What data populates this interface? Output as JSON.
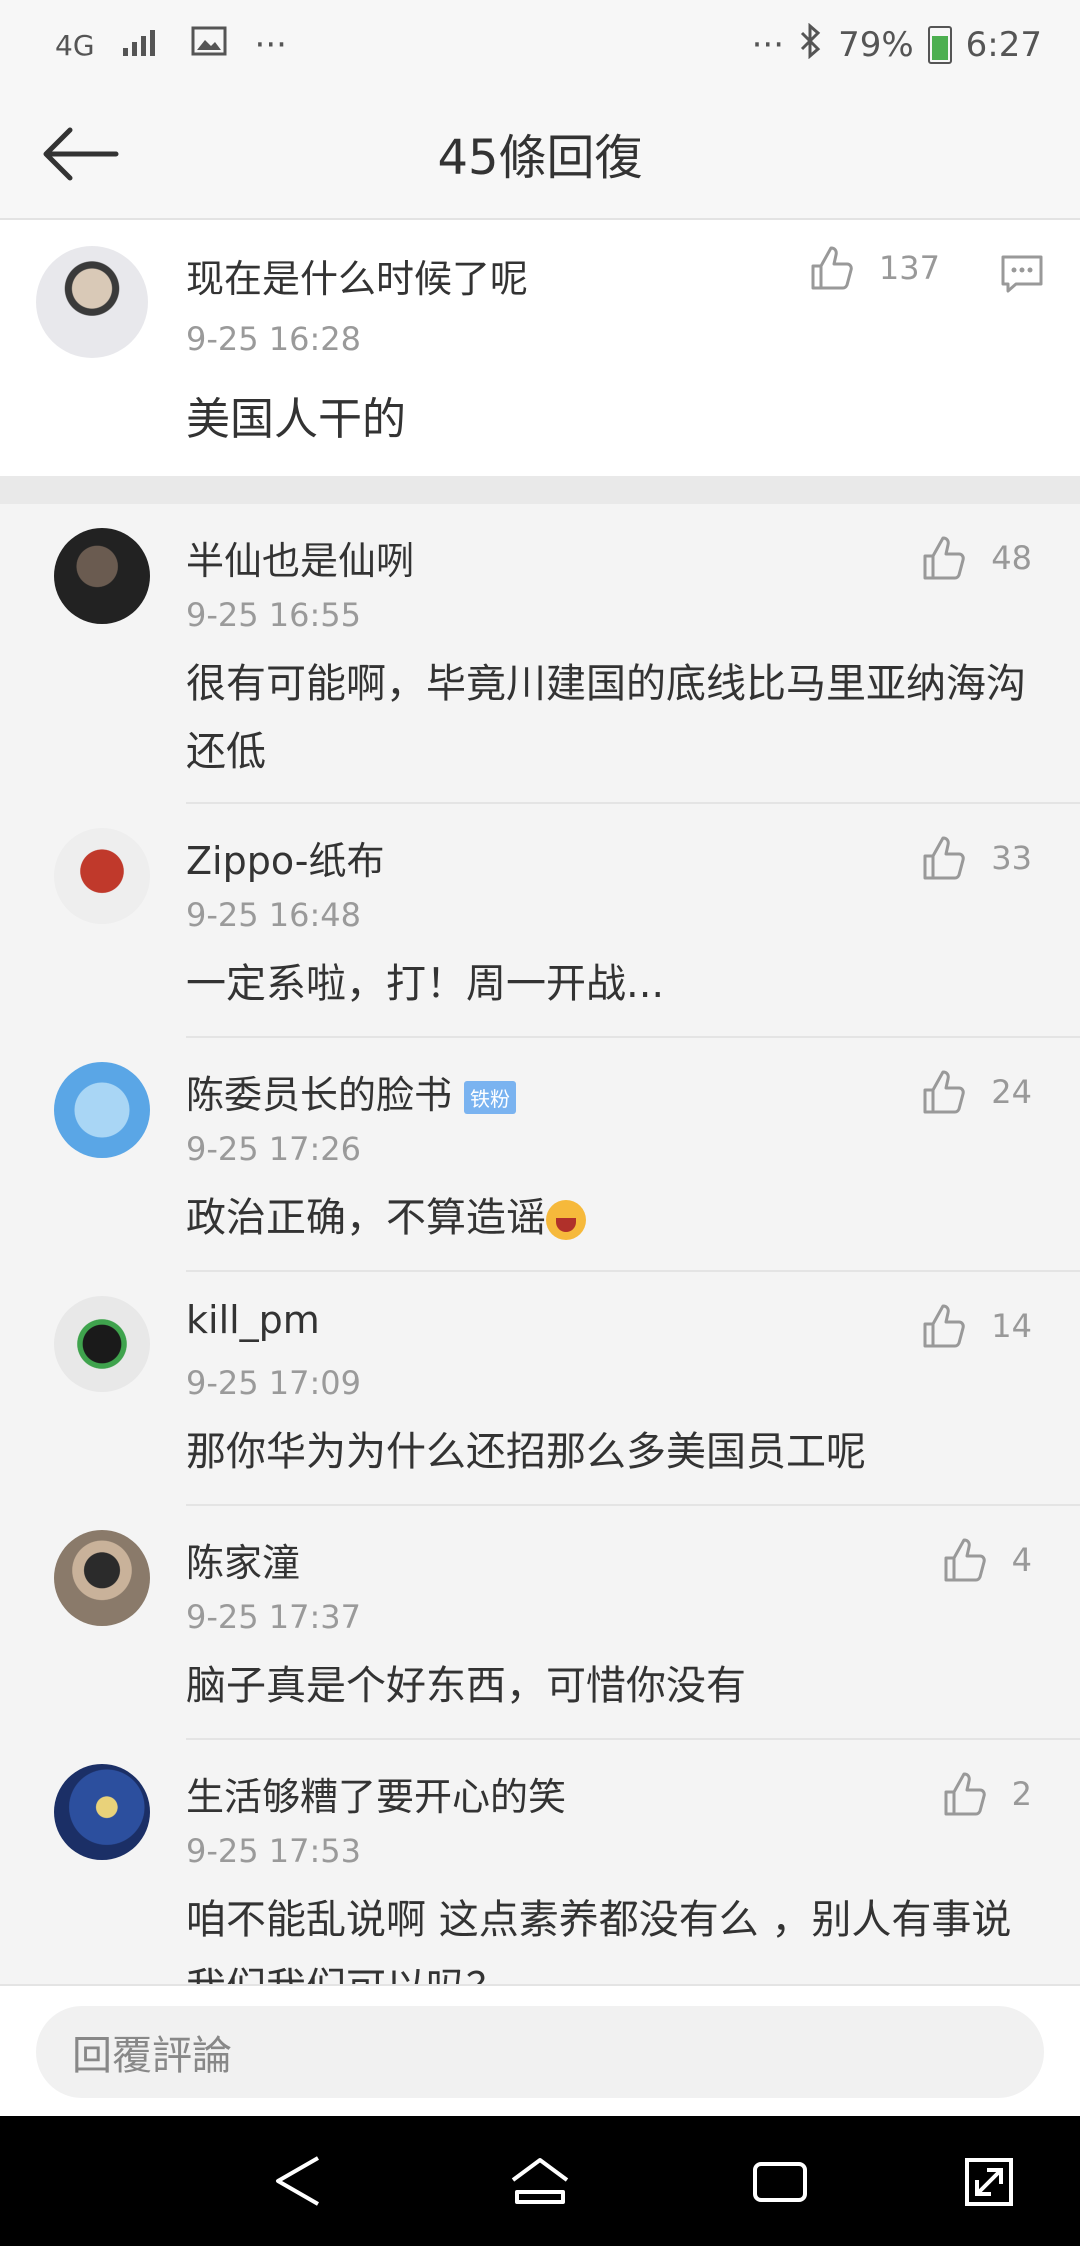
{
  "status": {
    "network": "4G",
    "overflow": "···",
    "overflow2": "···",
    "battery": "79%",
    "time": "6:27"
  },
  "header": {
    "title": "45條回復"
  },
  "original_post": {
    "name": "现在是什么时候了呢",
    "time": "9-25 16:28",
    "text": "美国人干的",
    "likes": "137"
  },
  "replies": [
    {
      "name": "半仙也是仙咧",
      "time": "9-25 16:55",
      "text": "很有可能啊，毕竟川建国的底线比马里亚纳海沟还低",
      "likes": "48"
    },
    {
      "name": "Zippo-纸布",
      "time": "9-25 16:48",
      "text": "一定系啦，打！周一开战...",
      "likes": "33"
    },
    {
      "name": "陈委员长的脸书",
      "badge": "铁粉",
      "time": "9-25 17:26",
      "text": "政治正确，不算造谣",
      "likes": "24"
    },
    {
      "name": "kill_pm",
      "time": "9-25 17:09",
      "text": "那你华为为什么还招那么多美国员工呢",
      "likes": "14"
    },
    {
      "name": "陈家潼",
      "time": "9-25 17:37",
      "text": "脑子真是个好东西，可惜你没有",
      "likes": "4"
    },
    {
      "name": "生活够糟了要开心的笑",
      "time": "9-25 17:53",
      "text": "咱不能乱说啊 这点素养都没有么 ，别人有事说我们我们可以吗？",
      "likes": "2"
    }
  ],
  "footer": {
    "reply_placeholder": "回覆評論"
  }
}
